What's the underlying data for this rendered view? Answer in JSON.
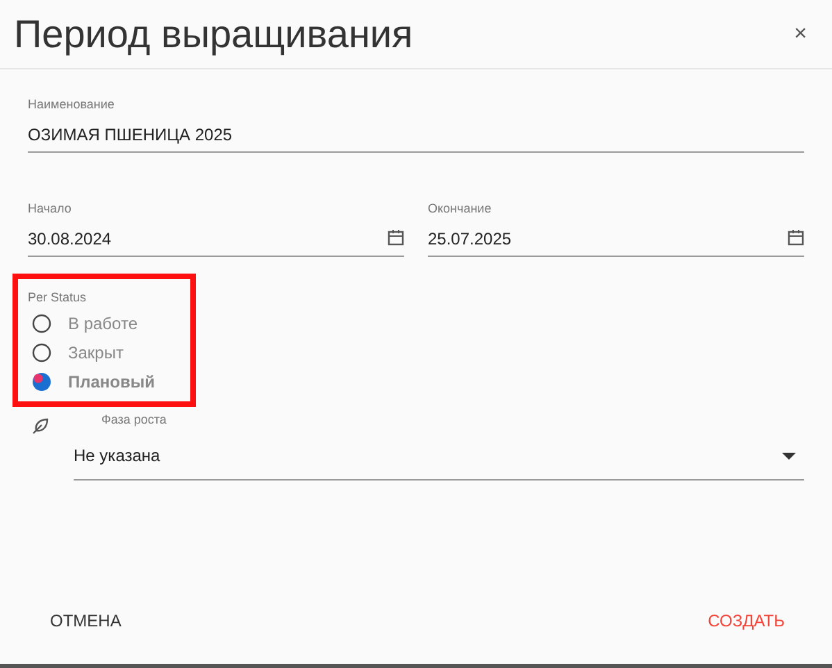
{
  "window": {
    "title": "Период выращивания",
    "close": "×"
  },
  "name_field": {
    "label": "Наименование",
    "value": "ОЗИМАЯ ПШЕНИЦА 2025"
  },
  "dates": [
    {
      "label": "Начало",
      "value": "30.08.2024"
    },
    {
      "label": "Окончание",
      "value": "25.07.2025"
    }
  ],
  "status": {
    "label": "Per Status",
    "highlighted": true,
    "options": [
      {
        "label": "В работе",
        "selected": false
      },
      {
        "label": "Закрыт",
        "selected": false
      },
      {
        "label": "Плановый",
        "selected": true
      }
    ]
  },
  "phase": {
    "label": "Фаза роста",
    "value": "Не указана"
  },
  "buttons": [
    {
      "label": "ОТМЕНА",
      "kind": "cancel"
    },
    {
      "label": "СОЗДАТЬ",
      "kind": "primary"
    }
  ]
}
